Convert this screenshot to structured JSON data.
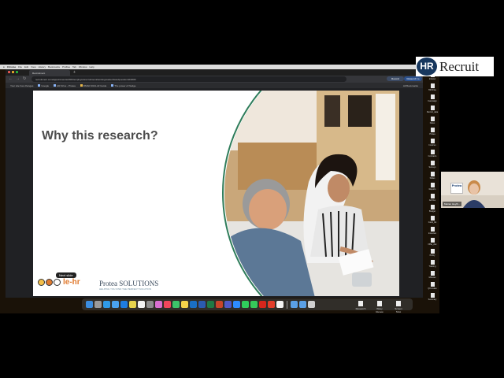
{
  "menubar": {
    "items": [
      "Chrome",
      "File",
      "Edit",
      "View",
      "History",
      "Bookmarks",
      "Profiles",
      "Tab",
      "Window",
      "Help"
    ],
    "status": "Fri 15:10"
  },
  "browser": {
    "tab_title": "Recruitment",
    "new_tab": "+",
    "back": "←",
    "forward": "→",
    "reload": "↻",
    "url": "recruitment.com/appointments/2023/employersrecruitment/workingmasterclass/question/id/2083",
    "record_label": "Record",
    "update_label": "Relaunch to update",
    "bookmarks": [
      "Google",
      "HR Drive - Protea",
      "RMAR 2021-22 Guide",
      "The power of Nudge"
    ],
    "bookmarks_left": "Your site has changes",
    "bookmarks_right": "All Bookmarks"
  },
  "slide": {
    "title": "Why this research?",
    "tooltip": "Next slide",
    "logo_left": "le-hr",
    "logo_right": "Protea SOLUTIONS",
    "logo_right_tag": "HELPING YOU FIND THE PERFECT SOLUTION"
  },
  "desktop_files": [
    "Research",
    "Wavy Renew",
    "Screen Shot"
  ],
  "icon_column": [
    "Intranet",
    "HR Drive",
    "Campaign",
    "Recruit_data",
    "Notes",
    "Protea",
    "Invoices",
    "Contracts",
    "Surveys",
    "Slides",
    "Reports",
    "Archive",
    "Budget",
    "Cand_list",
    "Interview",
    "Offer_doc",
    "Policy",
    "Training",
    "Minutes",
    "Q3 review",
    "Summary"
  ],
  "hr_badge": {
    "initials": "HR",
    "label": "Recruit"
  },
  "webcam": {
    "sign": "Protea",
    "name": "Marian Heyth..."
  },
  "colors": {
    "accent": "#17375e",
    "orange": "#e07a2f",
    "slide_ring": "#2f7d5b"
  }
}
